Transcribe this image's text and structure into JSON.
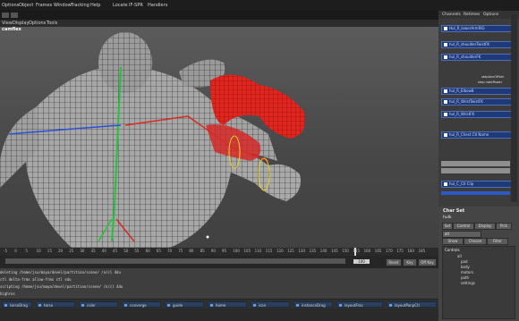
{
  "app": {
    "menu": [
      "Options",
      "Object",
      "Frames",
      "Window",
      "Tracking",
      "Help",
      "Locate",
      "IF-SPR",
      "Handlers"
    ],
    "viewport_menu": [
      "View",
      "Display",
      "Options",
      "Tools"
    ],
    "camera_label": "camflex"
  },
  "timeline": {
    "ticks": [
      "-5",
      "0",
      "5",
      "10",
      "15",
      "20",
      "25",
      "30",
      "35",
      "40",
      "45",
      "50",
      "55",
      "60",
      "65",
      "70",
      "75",
      "80",
      "85",
      "90",
      "95",
      "100",
      "105",
      "110",
      "115",
      "120",
      "125",
      "130",
      "135",
      "140",
      "145",
      "150",
      "155",
      "160",
      "165",
      "170",
      "175",
      "180",
      "185"
    ],
    "current_frame": "100",
    "range_end": "100",
    "buttons": [
      "Reset",
      "Key",
      "Off Key"
    ]
  },
  "script_editor": {
    "lines": [
      "deleting /home/jsu/maya/devel/partition/scene/ /n/cl 4du",
      "ctl  delta-frms  allow-frms   ctl  sdu",
      "scripting /home/jsu/maya/devel/partition/scene/ /n/cl 4du",
      "highres"
    ]
  },
  "pose_shelf": [
    "torsoDrag",
    "torso",
    "color",
    "converge",
    "guide",
    "home",
    "icon",
    "instanceDrag",
    "layoutFrac",
    "layoutPanpCtl"
  ],
  "channel_box": {
    "tabs": [
      "Channels",
      "Retimes",
      "Options"
    ],
    "selected": [
      {
        "label": "Hul_R_lowerArmRIG"
      },
      {
        "label": "hul_R_shoulderTwistFK"
      },
      {
        "label": "hul_R_shoulderFK"
      },
      {
        "label": "hul_R_Elbow8"
      },
      {
        "label": "hul_R_WristTwistFK"
      },
      {
        "label": "hul_R_WristFK"
      },
      {
        "label": "hul_R_Chest Ctl Name"
      },
      {
        "label": "hul_CentilL C"
      },
      {
        "label": "hul_C_Ctl Clip"
      }
    ],
    "notes": [
      "stepAnnOffset",
      "step notePower"
    ]
  },
  "char_set": {
    "title": "Char Set",
    "bulk": "hulk",
    "tabs": [
      "Set",
      "Control",
      "Display",
      "Pick"
    ],
    "filter_value": "all",
    "options": [
      "Show",
      "Choose",
      "Filter"
    ],
    "list_header": "Controls",
    "tree": [
      "all",
      "pad",
      "body",
      "motors",
      "path",
      "settings"
    ]
  },
  "colors": {
    "selection": "#1e3a78",
    "accent_red": "#e0261f"
  }
}
